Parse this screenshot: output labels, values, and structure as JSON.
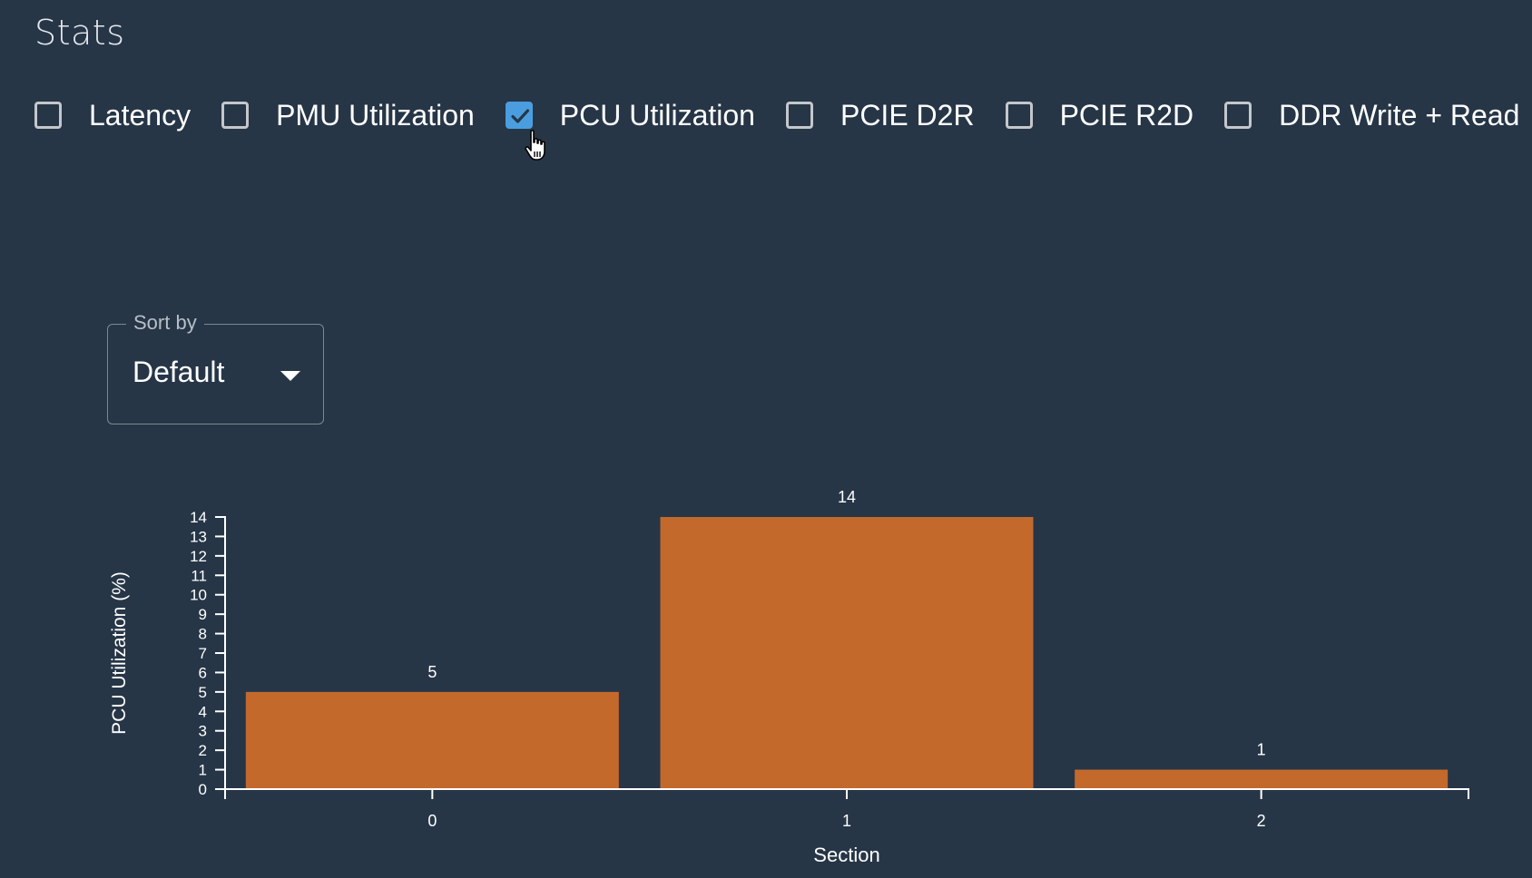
{
  "page": {
    "title": "Stats"
  },
  "stats_toggles": [
    {
      "label": "Latency",
      "checked": false
    },
    {
      "label": "PMU Utilization",
      "checked": false
    },
    {
      "label": "PCU Utilization",
      "checked": true
    },
    {
      "label": "PCIE D2R",
      "checked": false
    },
    {
      "label": "PCIE R2D",
      "checked": false
    },
    {
      "label": "DDR Write + Read",
      "checked": false
    }
  ],
  "sort": {
    "label": "Sort by",
    "value": "Default"
  },
  "colors": {
    "bar": "#c4692c",
    "checkbox_on": "#4a9ee0",
    "background": "#263647"
  },
  "chart_data": {
    "type": "bar",
    "title": "",
    "xlabel": "Section",
    "ylabel": "PCU Utilization (%)",
    "categories": [
      "0",
      "1",
      "2"
    ],
    "values": [
      5,
      14,
      1
    ],
    "data_labels": [
      "5",
      "14",
      "1"
    ],
    "ylim": [
      0,
      14
    ],
    "yticks": [
      0,
      1,
      2,
      3,
      4,
      5,
      6,
      7,
      8,
      9,
      10,
      11,
      12,
      13,
      14
    ],
    "grid": false,
    "legend": "none"
  }
}
